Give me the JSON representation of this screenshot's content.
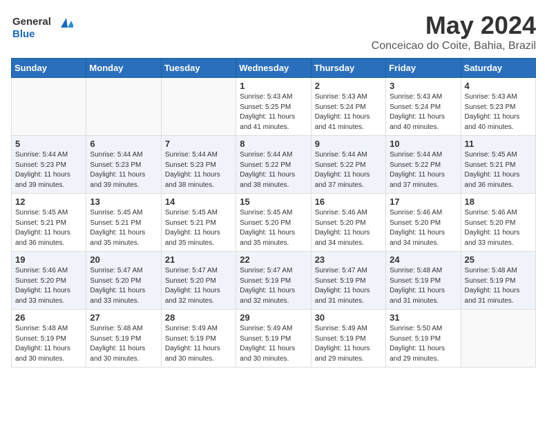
{
  "header": {
    "logo_general": "General",
    "logo_blue": "Blue",
    "month_title": "May 2024",
    "location": "Conceicao do Coite, Bahia, Brazil"
  },
  "days_of_week": [
    "Sunday",
    "Monday",
    "Tuesday",
    "Wednesday",
    "Thursday",
    "Friday",
    "Saturday"
  ],
  "weeks": [
    [
      {
        "day": "",
        "info": ""
      },
      {
        "day": "",
        "info": ""
      },
      {
        "day": "",
        "info": ""
      },
      {
        "day": "1",
        "info": "Sunrise: 5:43 AM\nSunset: 5:25 PM\nDaylight: 11 hours and 41 minutes."
      },
      {
        "day": "2",
        "info": "Sunrise: 5:43 AM\nSunset: 5:24 PM\nDaylight: 11 hours and 41 minutes."
      },
      {
        "day": "3",
        "info": "Sunrise: 5:43 AM\nSunset: 5:24 PM\nDaylight: 11 hours and 40 minutes."
      },
      {
        "day": "4",
        "info": "Sunrise: 5:43 AM\nSunset: 5:23 PM\nDaylight: 11 hours and 40 minutes."
      }
    ],
    [
      {
        "day": "5",
        "info": "Sunrise: 5:44 AM\nSunset: 5:23 PM\nDaylight: 11 hours and 39 minutes."
      },
      {
        "day": "6",
        "info": "Sunrise: 5:44 AM\nSunset: 5:23 PM\nDaylight: 11 hours and 39 minutes."
      },
      {
        "day": "7",
        "info": "Sunrise: 5:44 AM\nSunset: 5:23 PM\nDaylight: 11 hours and 38 minutes."
      },
      {
        "day": "8",
        "info": "Sunrise: 5:44 AM\nSunset: 5:22 PM\nDaylight: 11 hours and 38 minutes."
      },
      {
        "day": "9",
        "info": "Sunrise: 5:44 AM\nSunset: 5:22 PM\nDaylight: 11 hours and 37 minutes."
      },
      {
        "day": "10",
        "info": "Sunrise: 5:44 AM\nSunset: 5:22 PM\nDaylight: 11 hours and 37 minutes."
      },
      {
        "day": "11",
        "info": "Sunrise: 5:45 AM\nSunset: 5:21 PM\nDaylight: 11 hours and 36 minutes."
      }
    ],
    [
      {
        "day": "12",
        "info": "Sunrise: 5:45 AM\nSunset: 5:21 PM\nDaylight: 11 hours and 36 minutes."
      },
      {
        "day": "13",
        "info": "Sunrise: 5:45 AM\nSunset: 5:21 PM\nDaylight: 11 hours and 35 minutes."
      },
      {
        "day": "14",
        "info": "Sunrise: 5:45 AM\nSunset: 5:21 PM\nDaylight: 11 hours and 35 minutes."
      },
      {
        "day": "15",
        "info": "Sunrise: 5:45 AM\nSunset: 5:20 PM\nDaylight: 11 hours and 35 minutes."
      },
      {
        "day": "16",
        "info": "Sunrise: 5:46 AM\nSunset: 5:20 PM\nDaylight: 11 hours and 34 minutes."
      },
      {
        "day": "17",
        "info": "Sunrise: 5:46 AM\nSunset: 5:20 PM\nDaylight: 11 hours and 34 minutes."
      },
      {
        "day": "18",
        "info": "Sunrise: 5:46 AM\nSunset: 5:20 PM\nDaylight: 11 hours and 33 minutes."
      }
    ],
    [
      {
        "day": "19",
        "info": "Sunrise: 5:46 AM\nSunset: 5:20 PM\nDaylight: 11 hours and 33 minutes."
      },
      {
        "day": "20",
        "info": "Sunrise: 5:47 AM\nSunset: 5:20 PM\nDaylight: 11 hours and 33 minutes."
      },
      {
        "day": "21",
        "info": "Sunrise: 5:47 AM\nSunset: 5:20 PM\nDaylight: 11 hours and 32 minutes."
      },
      {
        "day": "22",
        "info": "Sunrise: 5:47 AM\nSunset: 5:19 PM\nDaylight: 11 hours and 32 minutes."
      },
      {
        "day": "23",
        "info": "Sunrise: 5:47 AM\nSunset: 5:19 PM\nDaylight: 11 hours and 31 minutes."
      },
      {
        "day": "24",
        "info": "Sunrise: 5:48 AM\nSunset: 5:19 PM\nDaylight: 11 hours and 31 minutes."
      },
      {
        "day": "25",
        "info": "Sunrise: 5:48 AM\nSunset: 5:19 PM\nDaylight: 11 hours and 31 minutes."
      }
    ],
    [
      {
        "day": "26",
        "info": "Sunrise: 5:48 AM\nSunset: 5:19 PM\nDaylight: 11 hours and 30 minutes."
      },
      {
        "day": "27",
        "info": "Sunrise: 5:48 AM\nSunset: 5:19 PM\nDaylight: 11 hours and 30 minutes."
      },
      {
        "day": "28",
        "info": "Sunrise: 5:49 AM\nSunset: 5:19 PM\nDaylight: 11 hours and 30 minutes."
      },
      {
        "day": "29",
        "info": "Sunrise: 5:49 AM\nSunset: 5:19 PM\nDaylight: 11 hours and 30 minutes."
      },
      {
        "day": "30",
        "info": "Sunrise: 5:49 AM\nSunset: 5:19 PM\nDaylight: 11 hours and 29 minutes."
      },
      {
        "day": "31",
        "info": "Sunrise: 5:50 AM\nSunset: 5:19 PM\nDaylight: 11 hours and 29 minutes."
      },
      {
        "day": "",
        "info": ""
      }
    ]
  ]
}
